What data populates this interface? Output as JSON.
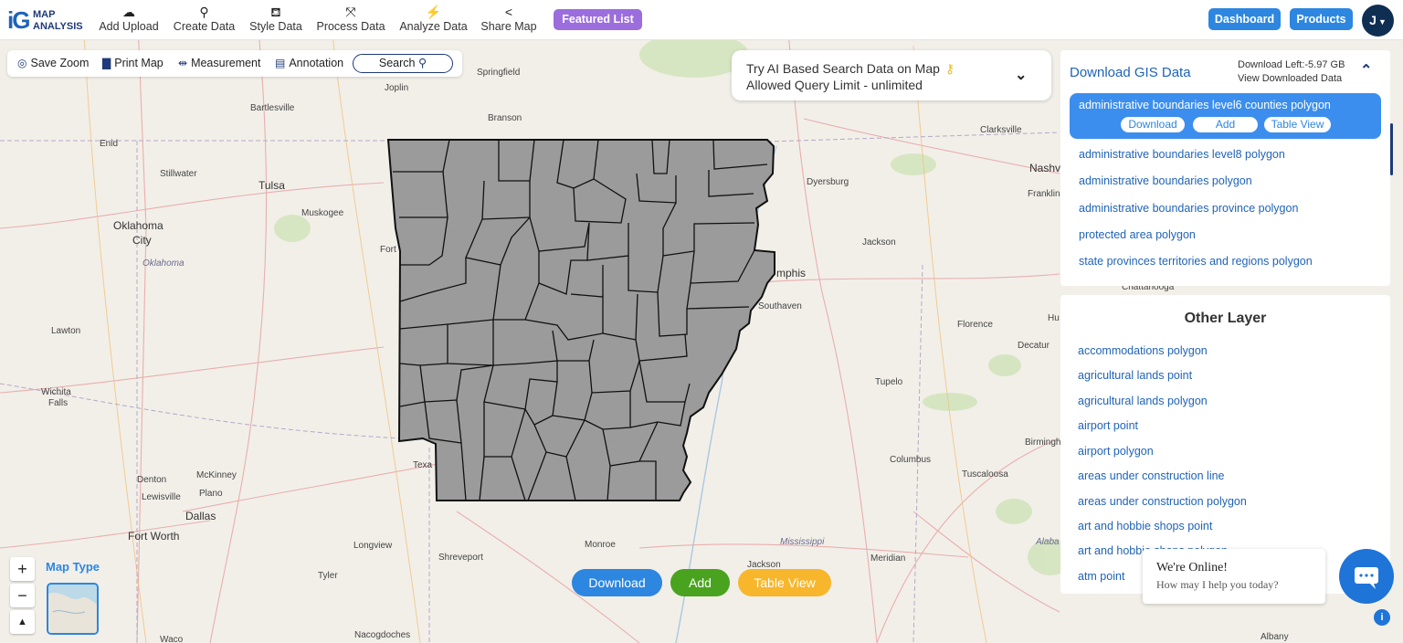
{
  "app": {
    "logo_mark": "iG",
    "logo_line1": "MAP",
    "logo_line2": "ANALYSIS"
  },
  "nav": [
    {
      "label": "Add Upload",
      "icon": "cloud-upload-icon"
    },
    {
      "label": "Create Data",
      "icon": "map-pin-icon"
    },
    {
      "label": "Style Data",
      "icon": "paint-bucket-icon"
    },
    {
      "label": "Process Data",
      "icon": "process-nodes-icon"
    },
    {
      "label": "Analyze Data",
      "icon": "analyze-icon"
    },
    {
      "label": "Share Map",
      "icon": "share-icon"
    }
  ],
  "header": {
    "featured": "Featured List",
    "dashboard": "Dashboard",
    "products": "Products",
    "avatar": "J"
  },
  "tools": {
    "save_zoom": "Save Zoom",
    "print_map": "Print Map",
    "measurement": "Measurement",
    "annotation": "Annotation",
    "search": "Search"
  },
  "ai": {
    "line1": "Try AI Based Search Data on Map",
    "line2": "Allowed Query Limit - unlimited"
  },
  "gis": {
    "title": "Download GIS Data",
    "download_left": "Download Left:-5.97 GB",
    "view_downloaded": "View Downloaded Data",
    "selected": "administrative boundaries level6 counties polygon",
    "sel_download": "Download",
    "sel_add": "Add",
    "sel_table": "Table View",
    "items": [
      "administrative boundaries level8 polygon",
      "administrative boundaries polygon",
      "administrative boundaries province polygon",
      "protected area polygon",
      "state provinces territories and regions polygon"
    ]
  },
  "other": {
    "title": "Other Layer",
    "items": [
      "accommodations polygon",
      "agricultural lands point",
      "agricultural lands polygon",
      "airport point",
      "airport polygon",
      "areas under construction line",
      "areas under construction polygon",
      "art and hobbie shops point",
      "art and hobbie shops polygon",
      "atm point"
    ]
  },
  "chat": {
    "line1": "We're Online!",
    "line2": "How may I help you today?"
  },
  "actions": {
    "download": "Download",
    "add": "Add",
    "table_view": "Table View"
  },
  "map_controls": {
    "zoom_in": "+",
    "zoom_out": "−",
    "map_type": "Map Type"
  },
  "map_labels": [
    "Springfield",
    "Joplin",
    "Bartlesville",
    "Branson",
    "Enid",
    "Stillwater",
    "Tulsa",
    "Muskogee",
    "Oklahoma",
    "City",
    "Oklahoma",
    "Fort",
    "Lawton",
    "Wichita",
    "Falls",
    "Clarksville",
    "Nashv",
    "Franklin",
    "Dyersburg",
    "Jackson",
    "mphis",
    "Southaven",
    "Chattanooga",
    "Florence",
    "Decatur",
    "Hu",
    "Tupelo",
    "Birmingh",
    "Columbus",
    "Tuscaloosa",
    "Alaba",
    "Mississippi",
    "Meridian",
    "Jackson",
    "Monroe",
    "Shreveport",
    "Longview",
    "Tyler",
    "Nacogdoches",
    "Denton",
    "McKinney",
    "Lewisville",
    "Plano",
    "Dallas",
    "Fort Worth",
    "Texa",
    "Waco",
    "Albany"
  ],
  "colors": {
    "accent": "#2d86e0",
    "featured": "#9b6ddd",
    "add": "#4aa31f",
    "table": "#f7b62c",
    "county_fill": "#9b9b9b"
  }
}
